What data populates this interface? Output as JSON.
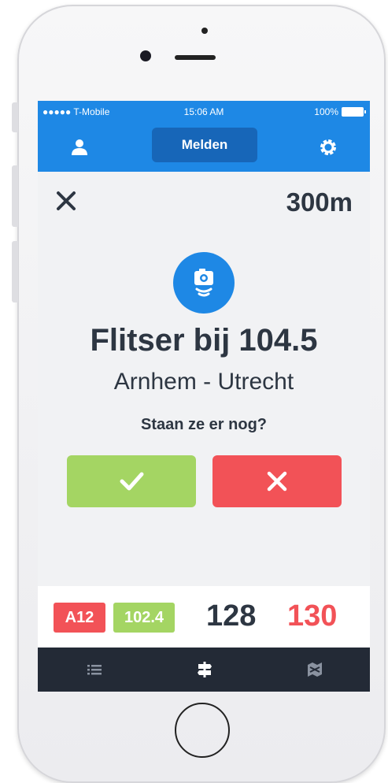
{
  "status": {
    "carrier": "●●●●● T-Mobile",
    "time": "15:06 AM",
    "battery": "100%"
  },
  "nav": {
    "title": "Melden",
    "left_icon": "user-icon",
    "right_icon": "gear-icon"
  },
  "alert": {
    "distance": "300m",
    "icon": "speed-camera-icon",
    "title": "Flitser bij 104.5",
    "route": "Arnhem - Utrecht",
    "question": "Staan ze er nog?",
    "confirm_icon": "checkmark-icon",
    "deny_icon": "close-icon"
  },
  "info": {
    "road": "A12",
    "km": "102.4",
    "current_speed": "128",
    "speed_limit": "130"
  },
  "tabs": [
    {
      "icon": "list-icon",
      "active": false
    },
    {
      "icon": "signpost-icon",
      "active": true
    },
    {
      "icon": "map-icon",
      "active": false
    }
  ],
  "colors": {
    "primary": "#1e88e5",
    "success": "#a4d563",
    "danger": "#f25257",
    "dark": "#2d3642",
    "tabbar": "#232a36"
  }
}
